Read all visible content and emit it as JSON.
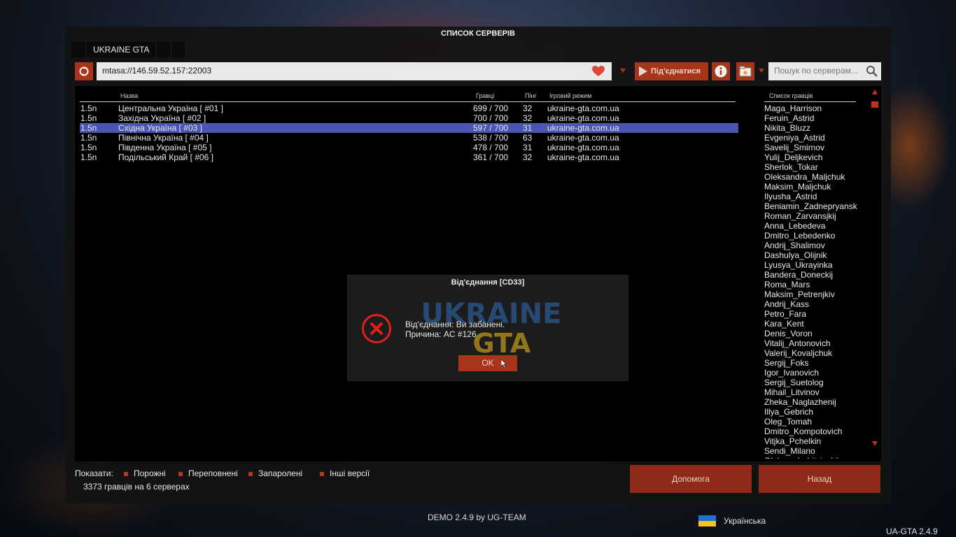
{
  "window": {
    "title": "СПИСОК СЕРВЕРІВ",
    "tab_label": "UKRAINE GTA"
  },
  "toolbar": {
    "url_value": "mtasa://146.59.52.157:22003",
    "connect_label": "Під'єднатися",
    "search_placeholder": "Пошук по серверам..."
  },
  "server_list": {
    "headers": {
      "name": "Назва",
      "players": "Гравці",
      "ping": "Пінг",
      "gamemode": "Ігровий режим"
    },
    "rows": [
      {
        "version": "1.5n",
        "name": "Центральна Україна [ #01 ]",
        "players": "699 / 700",
        "ping": "32",
        "gamemode": "ukraine-gta.com.ua"
      },
      {
        "version": "1.5n",
        "name": "Західна Україна [ #02 ]",
        "players": "700 / 700",
        "ping": "32",
        "gamemode": "ukraine-gta.com.ua"
      },
      {
        "version": "1.5n",
        "name": "Східна Україна [ #03 ]",
        "players": "597 / 700",
        "ping": "31",
        "gamemode": "ukraine-gta.com.ua"
      },
      {
        "version": "1.5n",
        "name": "Північна Україна [ #04 ]",
        "players": "538 / 700",
        "ping": "63",
        "gamemode": "ukraine-gta.com.ua"
      },
      {
        "version": "1.5n",
        "name": "Південна Україна [ #05 ]",
        "players": "478 / 700",
        "ping": "31",
        "gamemode": "ukraine-gta.com.ua"
      },
      {
        "version": "1.5n",
        "name": "Подільський Край [ #06 ]",
        "players": "361 / 700",
        "ping": "32",
        "gamemode": "ukraine-gta.com.ua"
      }
    ],
    "selected_index": 2
  },
  "players": {
    "header": "Список гравців",
    "items": [
      "Maga_Harrison",
      "Feruin_Astrid",
      "Nikita_Bluzz",
      "Evgeniya_Astrid",
      "Savelij_Smirnov",
      "Yulij_Deljkevich",
      "Sherlok_Tokar",
      "Oleksandra_Maljchuk",
      "Maksim_Maljchuk",
      "Ilyusha_Astrid",
      "Beniamin_Zadnepryansk",
      "Roman_Zarvansjkij",
      "Anna_Lebedeva",
      "Dmitro_Lebedenko",
      "Andrij_Shalimov",
      "Dashulya_Olijnik",
      "Lyusya_Ukrayinka",
      "Bandera_Doneckij",
      "Roma_Mars",
      "Maksim_Petrenjkiv",
      "Andrij_Kass",
      "Petro_Fara",
      "Kara_Kent",
      "Denis_Voron",
      "Vitalij_Antonovich",
      "Valerij_Kovaljchuk",
      "Sergij_Foks",
      "Igor_Ivanovich",
      "Sergij_Suetolog",
      "Mihail_Litvinov",
      "Zheka_Naglazhenij",
      "Illya_Gebrich",
      "Oleg_Tomah",
      "Dmitro_Kompotovich",
      "Vitjka_Pchelkin",
      "Sendi_Milano",
      "Oleksandr_Litvinskij"
    ]
  },
  "dialog": {
    "title": "Від'єднання [CD33]",
    "line1": "Від'єднання: Ви забанені.",
    "line2": "Причина: AC #126",
    "ok_label": "OK",
    "watermark_line1": "UKRAINE",
    "watermark_line2": "GTA"
  },
  "filters": {
    "show_label": "Показати:",
    "empty": "Порожні",
    "full": "Переповнені",
    "locked": "Запаролені",
    "other_versions": "Інші версії"
  },
  "status": {
    "summary": "3373 гравців на 6 серверах"
  },
  "buttons": {
    "help": "Допомога",
    "back": "Назад"
  },
  "footer": {
    "demo": "DEMO 2.4.9 by UG-TEAM",
    "language": "Українська",
    "version": "UA-GTA 2.4.9"
  },
  "colors": {
    "accent": "#a8341b",
    "selected_row": "#4a55b4",
    "panel": "#000000"
  }
}
